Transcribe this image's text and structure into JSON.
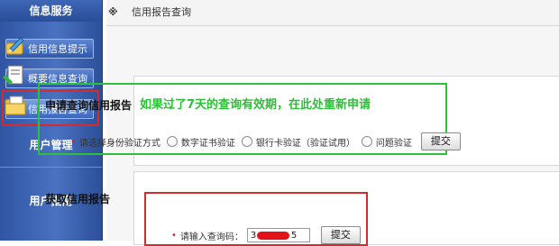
{
  "sidebar": {
    "header": "信息服务",
    "buttons": [
      {
        "label": "信用信息提示"
      },
      {
        "label": "概要信息查询"
      },
      {
        "label": "信用报告查询"
      }
    ],
    "sections": [
      "用户管理",
      "用户指南"
    ]
  },
  "topbar": {
    "mark": "※",
    "title": "信用报告查询"
  },
  "apply": {
    "title": "申请查询信用报告",
    "note": "如果过了7天的查询有效期，在此处重新申请",
    "verify_label": "请选择身份验证方式",
    "options": [
      "数字证书验证",
      "银行卡验证（验证试用）",
      "问题验证"
    ],
    "submit": "提交"
  },
  "get": {
    "title": "获取信用报告",
    "code_label": "请输入查询码：",
    "code_value_start": "3",
    "code_value_end": "5",
    "submit": "提交"
  },
  "colors": {
    "sidebar": "#3a62b0",
    "highlight_green": "#2fbf3b",
    "highlight_red": "#d72a2a"
  }
}
